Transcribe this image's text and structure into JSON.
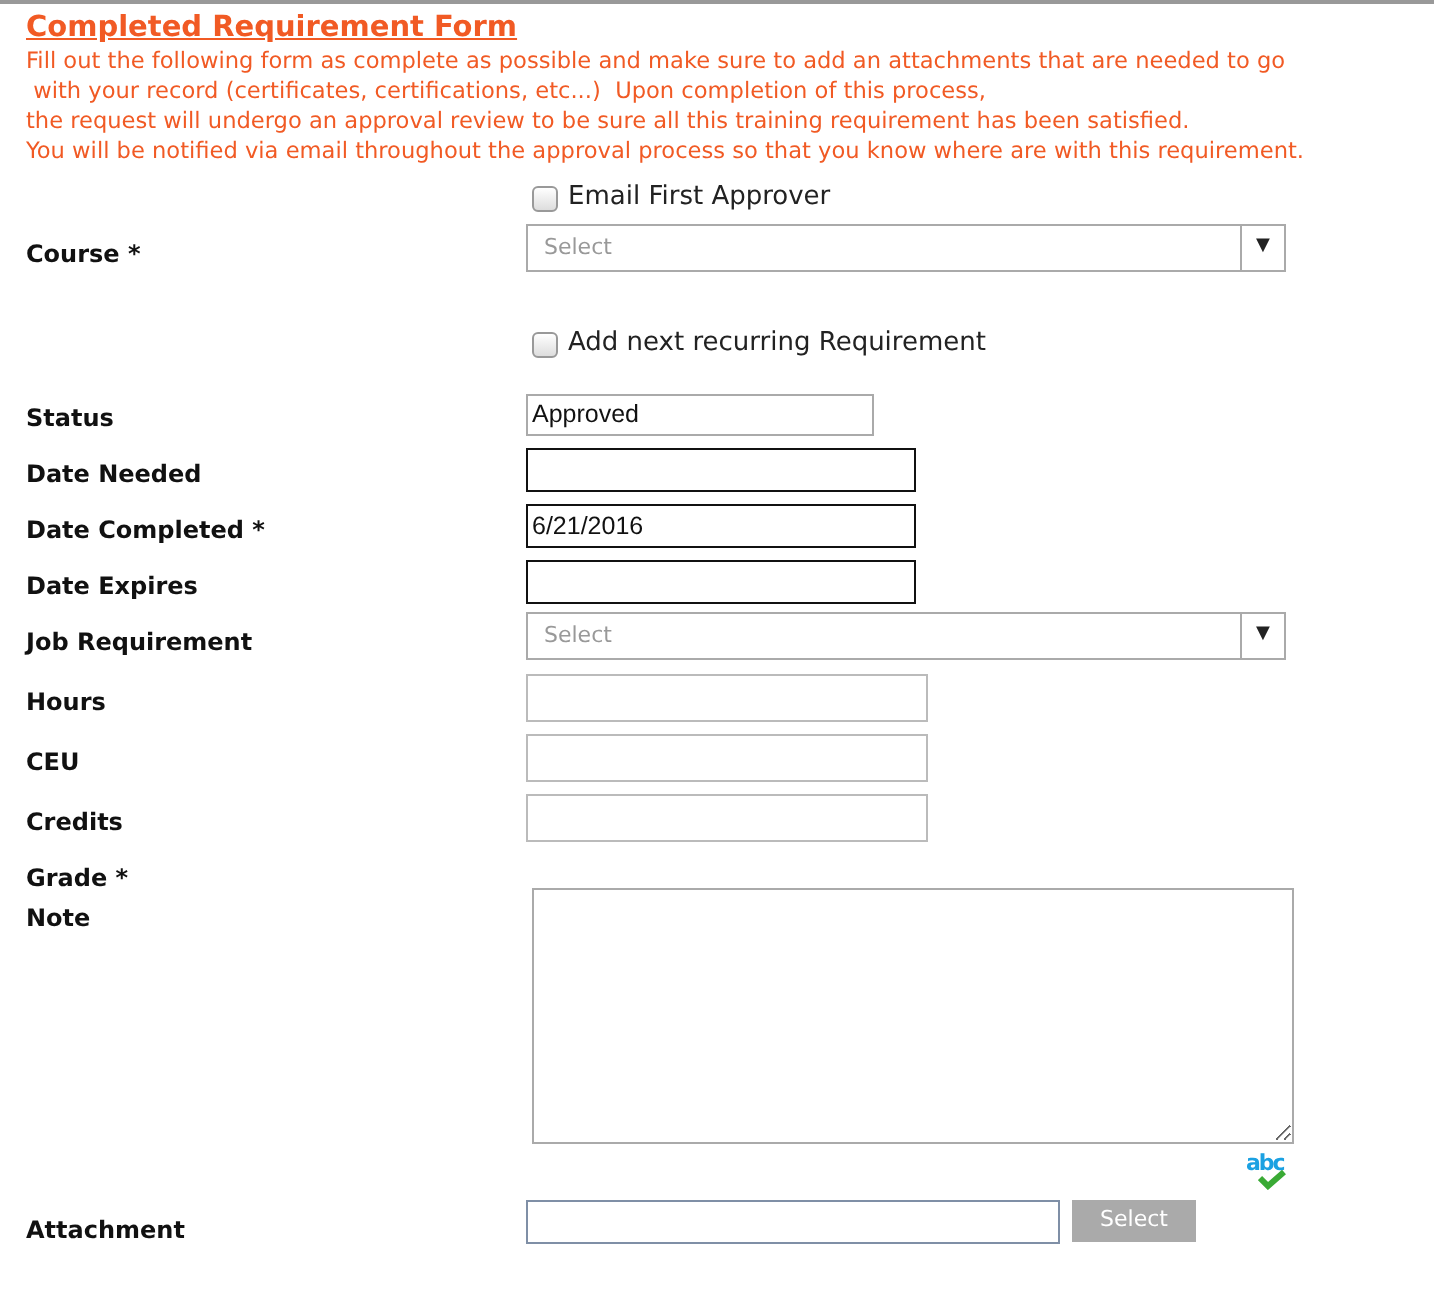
{
  "title": "Completed Requirement Form",
  "intro": [
    "Fill out the following form as complete as possible and make sure to add an attachments that are needed to go",
    " with your record (certificates, certifications, etc...)  Upon completion of this process,",
    "the request will undergo an approval review to be sure all this training requirement has been satisfied.",
    "You will be notified via email throughout the approval process so that you know where are with this requirement."
  ],
  "fields": [
    {
      "kind": "checkbox",
      "text": "Email First Approver",
      "checked": false
    },
    {
      "kind": "select",
      "label": "Course *",
      "placeholder": "Select",
      "arrow": "▼"
    },
    {
      "kind": "checkbox",
      "text": "Add next recurring Requirement",
      "checked": false
    },
    {
      "kind": "readonly",
      "label": "Status",
      "value": "Approved"
    },
    {
      "kind": "date",
      "label": "Date Needed"
    },
    {
      "kind": "date",
      "label": "Date Completed *",
      "value": "6/21/2016"
    },
    {
      "kind": "date",
      "label": "Date Expires"
    },
    {
      "kind": "select",
      "label": "Job Requirement",
      "placeholder": "Select",
      "arrow": "▼"
    },
    {
      "kind": "text",
      "label": "Hours"
    },
    {
      "kind": "text",
      "label": "CEU"
    },
    {
      "kind": "text",
      "label": "Credits"
    },
    {
      "kind": "label",
      "label": "Grade *"
    },
    {
      "kind": "textarea",
      "label": "Note",
      "spellcheck": "abc"
    },
    {
      "kind": "file",
      "label": "Attachment",
      "button": "Select"
    }
  ]
}
